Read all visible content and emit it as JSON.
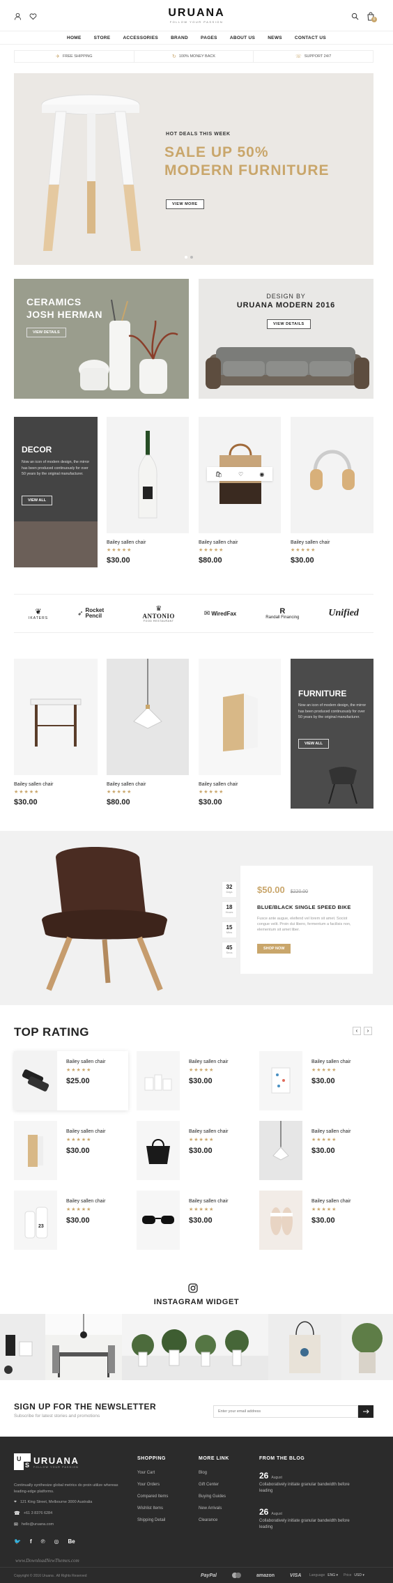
{
  "header": {
    "logo": "URUANA",
    "tagline": "FOLLOW YOUR PASSION",
    "cart_count": "0"
  },
  "nav": [
    "HOME",
    "STORE",
    "ACCESSORIES",
    "BRAND",
    "PAGES",
    "ABOUT US",
    "NEWS",
    "CONTACT US"
  ],
  "services": [
    "FREE SHIPPING",
    "100% MONEY BACK",
    "SUPPORT 24/7"
  ],
  "hero": {
    "kicker": "HOT DEALS THIS WEEK",
    "headline_1": "SALE UP 50%",
    "headline_2": "MODERN FURNITURE",
    "button": "VIEW MORE"
  },
  "banners": {
    "left": {
      "line1": "CERAMICS",
      "line2": "JOSH HERMAN",
      "button": "VIEW DETAILS"
    },
    "right": {
      "line1": "DESIGN BY",
      "line2": "URUANA MODERN 2016",
      "button": "VIEW DETAILS"
    }
  },
  "decor": {
    "title": "DECOR",
    "text": "Now an icon of modern design, the mirror has been produced continuously for over 50 years by the original manufacturer.",
    "button": "VIEW ALL"
  },
  "furniture": {
    "title": "FURNITURE",
    "text": "Now an icon of modern design, the mirror has been produced continuously for over 50 years by the original manufacturer.",
    "button": "VIEW ALL"
  },
  "products_row1": [
    {
      "name": "Bailey sallen chair",
      "stars": "★★★★★",
      "price": "$30.00"
    },
    {
      "name": "Bailey sallen chair",
      "stars": "★★★★★",
      "price": "$80.00"
    },
    {
      "name": "Bailey sallen chair",
      "stars": "★★★★★",
      "price": "$30.00"
    }
  ],
  "products_row2": [
    {
      "name": "Bailey sallen chair",
      "stars": "★★★★★",
      "price": "$30.00"
    },
    {
      "name": "Bailey sallen chair",
      "stars": "★★★★★",
      "price": "$80.00"
    },
    {
      "name": "Bailey sallen chair",
      "stars": "★★★★★",
      "price": "$30.00"
    }
  ],
  "brands": [
    "IKATERS",
    "Rocket Pencil",
    "ANTONIO",
    "WiredFax",
    "Randall Financing",
    "Unified"
  ],
  "brand_subs": {
    "antonio": "FOOD RESTAURANT"
  },
  "deal": {
    "countdown": [
      {
        "num": "32",
        "unit": "Days"
      },
      {
        "num": "18",
        "unit": "Hours"
      },
      {
        "num": "15",
        "unit": "Mins"
      },
      {
        "num": "45",
        "unit": "Secs"
      }
    ],
    "price": "$50.00",
    "old_price": "$220.00",
    "title": "BLUE/BLACK SINGLE SPEED BIKE",
    "text": "Fusce ante augue, eleifend vel lorem sit amet. Sociot congue velit. Proin dui libero, fermentum a facilisis non, elementum sit amet liber.",
    "button": "SHOP NOW"
  },
  "top_rating": {
    "title": "TOP RATING",
    "items": [
      {
        "name": "Bailey sallen chair",
        "stars": "★★★★★",
        "price": "$25.00"
      },
      {
        "name": "Bailey sallen chair",
        "stars": "★★★★★",
        "price": "$30.00"
      },
      {
        "name": "Bailey sallen chair",
        "stars": "★★★★★",
        "price": "$30.00"
      },
      {
        "name": "Bailey sallen chair",
        "stars": "★★★★★",
        "price": "$30.00"
      },
      {
        "name": "Bailey sallen chair",
        "stars": "★★★★★",
        "price": "$30.00"
      },
      {
        "name": "Bailey sallen chair",
        "stars": "★★★★★",
        "price": "$30.00"
      },
      {
        "name": "Bailey sallen chair",
        "stars": "★★★★★",
        "price": "$30.00"
      },
      {
        "name": "Bailey sallen chair",
        "stars": "★★★★★",
        "price": "$30.00"
      },
      {
        "name": "Bailey sallen chair",
        "stars": "★★★★★",
        "price": "$30.00"
      }
    ],
    "bottle_label": "23"
  },
  "instagram": {
    "title": "INSTAGRAM WIDGET"
  },
  "newsletter": {
    "title": "SIGN UP FOR THE NEWSLETTER",
    "subtitle": "Subscribe for latest stories and promotions",
    "placeholder": "Enter your email address"
  },
  "footer": {
    "logo": "URUANA",
    "tagline": "FOLLOW YOUR PASSION",
    "about": "Continually synthesize global metrics do proin utilize whereas leading-edge platforms.",
    "address": "121 King Street, Melbourne 3000 Australia",
    "phone": "+61 3 8376 6284",
    "email": "hello@uruana.com",
    "shopping_title": "SHOPPING",
    "shopping": [
      "Your Cart",
      "Your Orders",
      "Compared Items",
      "Wishlist Items",
      "Shipping Detail"
    ],
    "more_title": "MORE LINK",
    "more": [
      "Blog",
      "Gift Center",
      "Buying Guides",
      "New Arrivals",
      "Clearance"
    ],
    "blog_title": "FROM THE BLOG",
    "blog": [
      {
        "day": "26",
        "month": "August",
        "text": "Collaboratively initiate granular bandwidth before leading"
      },
      {
        "day": "26",
        "month": "August",
        "text": "Collaboratively initiate granular bandwidth before leading"
      }
    ],
    "social": [
      "Be"
    ],
    "copyright": "Copyright © 2016 Uruana . All Rights Reserved",
    "payments": [
      "PayPal",
      "amazon",
      "VISA"
    ],
    "lang_label": "Language",
    "lang_value": "ENG",
    "price_label": "Price",
    "price_value": "USD"
  },
  "watermark": "www.DownloadNewThemes.com",
  "colors": {
    "accent": "#c9a66b",
    "dark": "#2b2b2b",
    "banner_green": "#9a9d8d"
  }
}
